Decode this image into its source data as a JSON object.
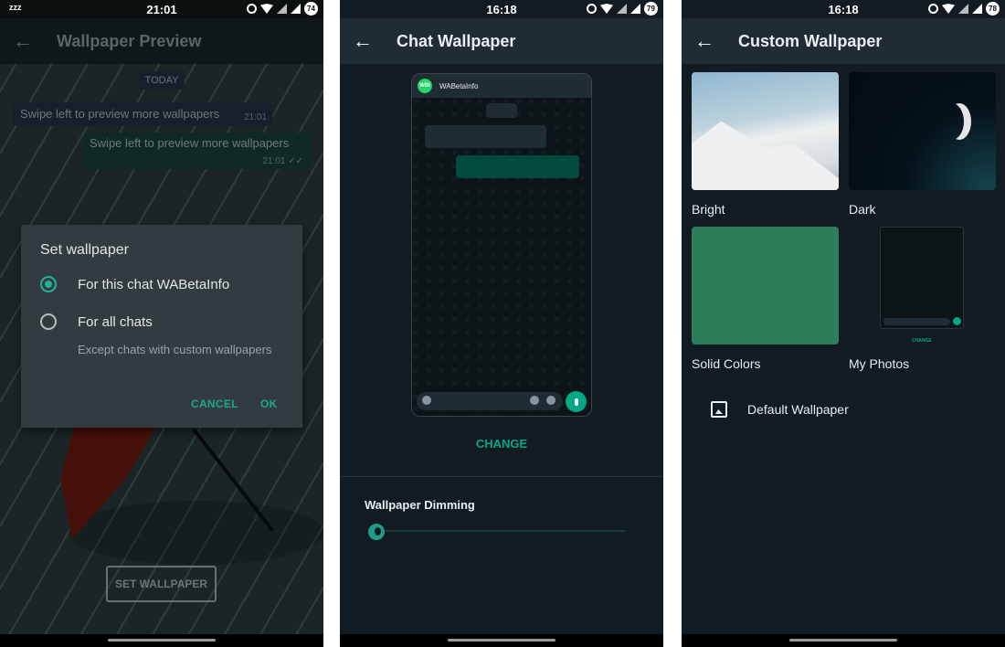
{
  "panel1": {
    "status": {
      "time": "21:01",
      "battery": "74",
      "left_icon": "zzz"
    },
    "appbar": {
      "title": "Wallpaper Preview",
      "back_icon": "arrow-back-icon"
    },
    "date_chip": "TODAY",
    "incoming_message": {
      "text": "Swipe left to preview more wallpapers",
      "time": "21:01"
    },
    "outgoing_message": {
      "text": "Swipe left to preview more wallpapers",
      "time": "21:01",
      "ticks": "✓✓"
    },
    "dialog": {
      "title": "Set wallpaper",
      "options": [
        {
          "label": "For this chat WABetaInfo",
          "selected": true
        },
        {
          "label": "For all chats",
          "sublabel": "Except chats with custom wallpapers",
          "selected": false
        }
      ],
      "cancel_label": "CANCEL",
      "ok_label": "OK"
    },
    "set_wallpaper_label": "SET WALLPAPER"
  },
  "panel2": {
    "status": {
      "time": "16:18",
      "battery": "79"
    },
    "appbar": {
      "title": "Chat Wallpaper",
      "back_icon": "arrow-back-icon"
    },
    "preview": {
      "avatar_text": "WBI",
      "contact_name": "WABetaInfo"
    },
    "change_label": "CHANGE",
    "dimming": {
      "label": "Wallpaper Dimming",
      "value_percent": 0
    }
  },
  "panel3": {
    "status": {
      "time": "16:18",
      "battery": "78"
    },
    "appbar": {
      "title": "Custom Wallpaper",
      "back_icon": "arrow-back-icon"
    },
    "categories": [
      {
        "label": "Bright"
      },
      {
        "label": "Dark"
      },
      {
        "label": "Solid Colors"
      },
      {
        "label": "My Photos",
        "mini_change_label": "CHANGE"
      }
    ],
    "default_wallpaper_label": "Default Wallpaper"
  },
  "colors": {
    "accent": "#00a884",
    "dark_bg": "#121b22",
    "appbar": "#1f2c34"
  }
}
